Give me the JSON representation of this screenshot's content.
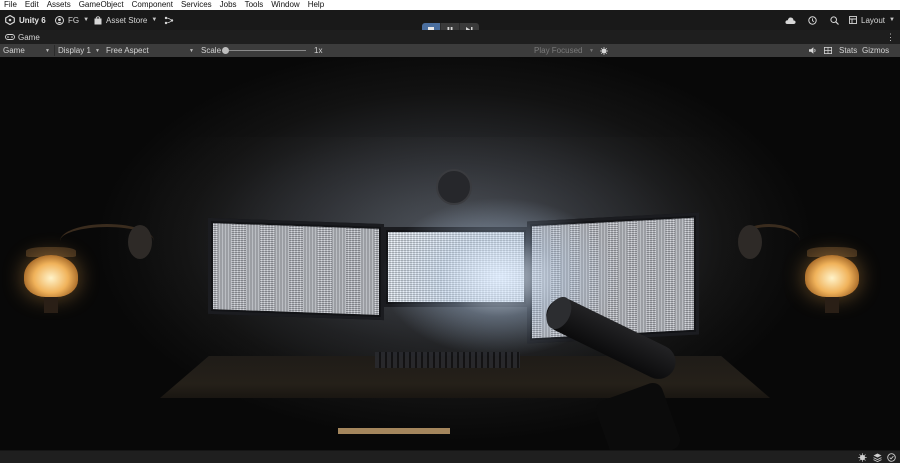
{
  "menu": [
    "File",
    "Edit",
    "Assets",
    "GameObject",
    "Component",
    "Services",
    "Jobs",
    "Tools",
    "Window",
    "Help"
  ],
  "toolbar": {
    "app_name": "Unity 6",
    "account_label": "FG",
    "store_label": "Asset Store",
    "layout_label": "Layout"
  },
  "tab": {
    "label": "Game"
  },
  "game_bar": {
    "view_select": "Game",
    "display_select": "Display 1",
    "aspect_select": "Free Aspect",
    "scale_label": "Scale",
    "scale_value": "1x",
    "play_mode_select": "Play Focused",
    "stats_label": "Stats",
    "gizmos_label": "Gizmos"
  },
  "icons": {
    "unity": "unity-logo-icon",
    "account": "user-icon",
    "store": "store-bag-icon",
    "share": "version-control-icon",
    "stop": "stop-icon",
    "pause": "pause-icon",
    "step": "step-icon",
    "cloud": "cloud-icon",
    "history": "history-icon",
    "search": "search-icon",
    "audio": "speaker-icon",
    "stats": "grid-icon",
    "bug": "bug-icon"
  },
  "colors": {
    "play_active": "#4a6e9e",
    "menu_bg": "#ffffff",
    "toolbar_bg": "#191919",
    "gamebar_bg": "#3c3c3c"
  }
}
